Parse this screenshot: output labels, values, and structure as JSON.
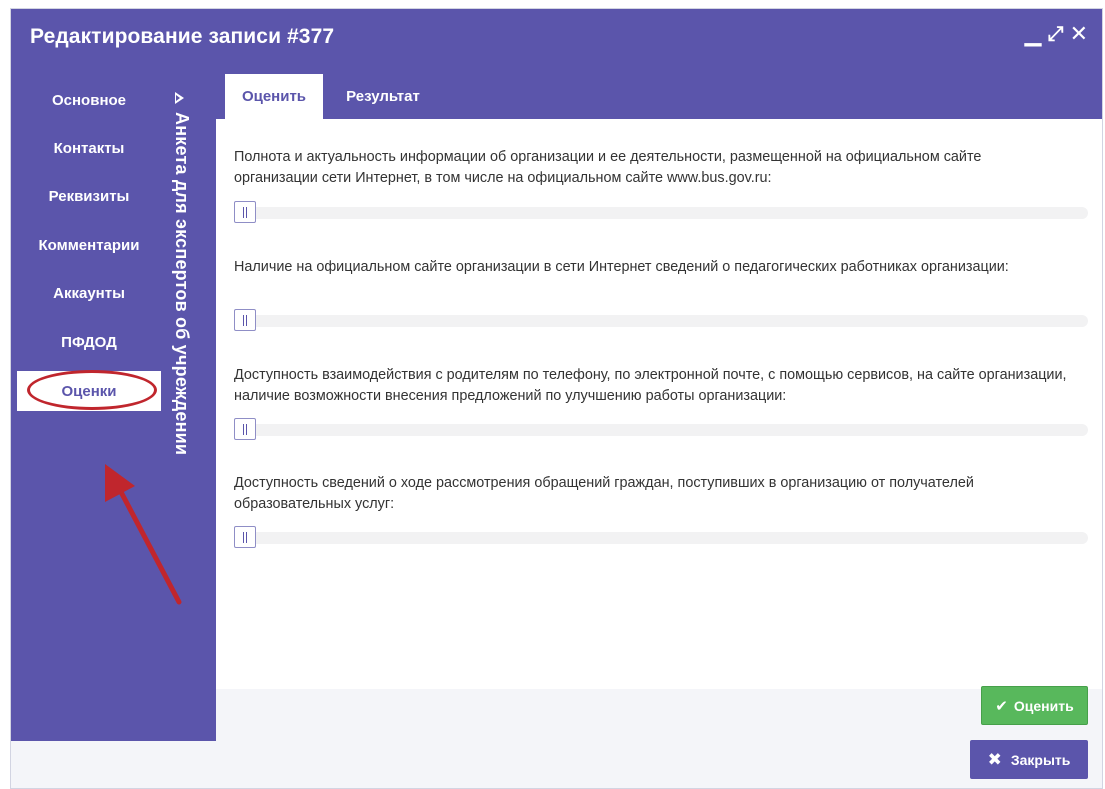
{
  "window": {
    "title": "Редактирование записи #377",
    "controls": {
      "minimize": "▁",
      "maximize": "⤢",
      "close": "✕"
    }
  },
  "sidebar": {
    "items": [
      {
        "label": "Основное"
      },
      {
        "label": "Контакты"
      },
      {
        "label": "Реквизиты"
      },
      {
        "label": "Комментарии"
      },
      {
        "label": "Аккаунты"
      },
      {
        "label": "ПФДОД"
      },
      {
        "label": "Оценки"
      }
    ],
    "active_item": "Оценки",
    "collapsed_panel_title": "Анкета для экспертов об учреждении",
    "annotation_color": "#c0262d"
  },
  "tabs": [
    {
      "label": "Оценить"
    },
    {
      "label": "Результат"
    }
  ],
  "questions": [
    {
      "text": "Полнота и актуальность информации об организации и ее деятельности, размещенной на официальном сайте организации сети Интернет, в том числе на официальном сайте www.bus.gov.ru:",
      "slider_value": 0
    },
    {
      "text": "Наличие на официальном сайте организации в сети Интернет сведений о педагогических работниках организации:",
      "slider_value": 0
    },
    {
      "text": "Доступность взаимодействия с родителям по телефону, по электронной почте, с помощью сервисов, на сайте организации, наличие возможности внесения предложений по улучшению работы организации:",
      "slider_value": 0
    },
    {
      "text": "Доступность сведений о ходе рассмотрения обращений граждан, поступивших в организацию от получателей образовательных услуг:",
      "slider_value": 0
    }
  ],
  "buttons": {
    "rate": {
      "label": "Оценить",
      "icon": "check-icon",
      "glyph": "✔",
      "color": "#58b85c"
    },
    "close": {
      "label": "Закрыть",
      "icon": "close-icon",
      "glyph": "✖",
      "color": "#5b55ab"
    }
  },
  "colors": {
    "accent": "#5b55ab",
    "success": "#58b85c"
  }
}
